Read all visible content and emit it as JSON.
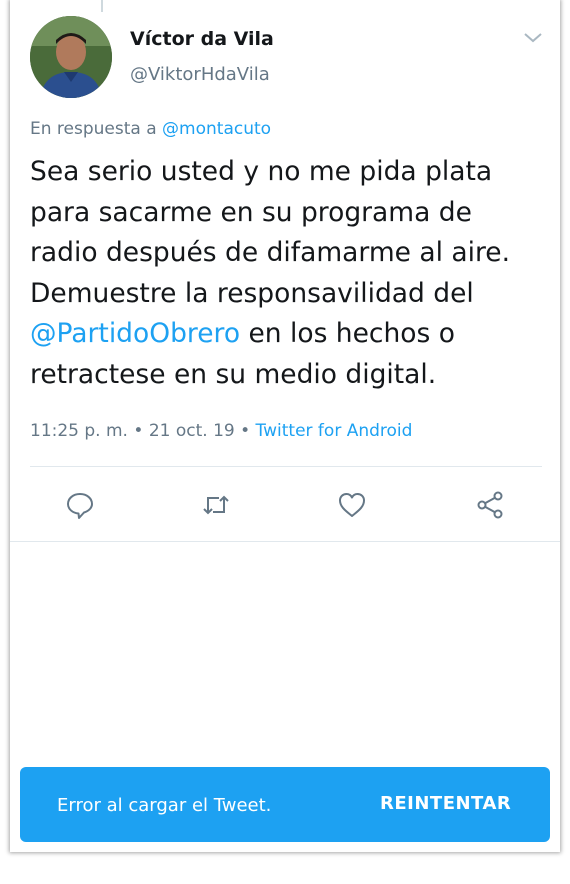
{
  "author": {
    "name": "Víctor da Vila",
    "handle": "@ViktorHdaVila",
    "avatar_icon": "profile-photo"
  },
  "reply": {
    "prefix": "En respuesta a",
    "mention": "@montacuto"
  },
  "tweet": {
    "text_part1": "Sea serio usted y no me pida plata para sacarme en su programa de radio después de difamarme al aire. Demuestre la responsavilidad del ",
    "mention": "@PartidoObrero",
    "text_part2": " en los hechos o retractese en su medio digital."
  },
  "meta": {
    "time": "11:25 p. m.",
    "date": "21 oct. 19",
    "source": "Twitter for Android",
    "separator": " • "
  },
  "actions": {
    "reply_icon": "reply-icon",
    "retweet_icon": "retweet-icon",
    "like_icon": "heart-icon",
    "share_icon": "share-icon"
  },
  "error": {
    "message": "Error al cargar el Tweet.",
    "retry_label": "REINTENTAR"
  },
  "colors": {
    "accent": "#1da1f2",
    "secondary_text": "#657786",
    "primary_text": "#14171a",
    "divider": "#e1e8ed"
  }
}
